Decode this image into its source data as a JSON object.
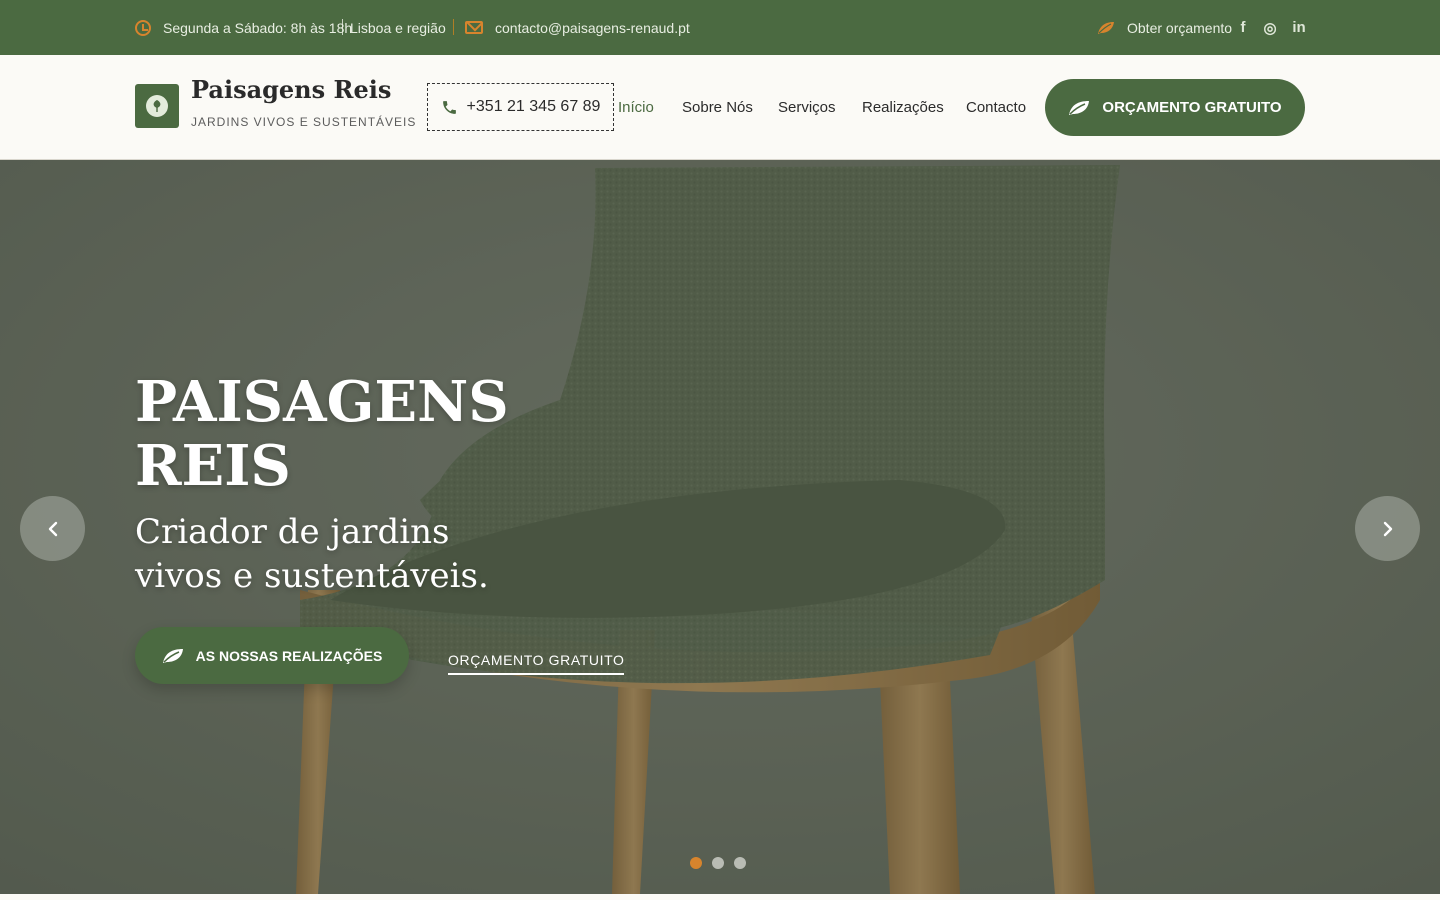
{
  "topbar": {
    "hours": "Segunda a Sábado: 8h às 18h",
    "region": "Lisboa e região",
    "email": "contacto@paisagens-renaud.pt",
    "quote_link": "Obter orçamento",
    "social": [
      {
        "icon": "facebook-icon",
        "glyph": "f"
      },
      {
        "icon": "instagram-icon",
        "glyph": "◎"
      },
      {
        "icon": "linkedin-icon",
        "glyph": "in"
      }
    ]
  },
  "header": {
    "brand_name": "Paisagens Reis",
    "brand_tagline": "JARDINS VIVOS E SUSTENTÁVEIS",
    "phone": "+351 21 345 67 89",
    "nav": [
      {
        "label": "Início",
        "active": true
      },
      {
        "label": "Sobre Nós",
        "active": false
      },
      {
        "label": "Serviços",
        "active": false
      },
      {
        "label": "Realizações",
        "active": false
      },
      {
        "label": "Contacto",
        "active": false
      }
    ],
    "cta_label": "ORÇAMENTO GRATUITO"
  },
  "hero": {
    "title_line1": "PAISAGENS",
    "title_line2": "REIS",
    "subtitle_line1": "Criador de jardins",
    "subtitle_line2": "vivos e sustentáveis.",
    "primary_button": "AS NOSSAS REALIZAÇÕES",
    "secondary_link": "ORÇAMENTO GRATUITO",
    "slides_count": 3,
    "active_slide": 1
  },
  "colors": {
    "brand_green": "#4b6a41",
    "accent_orange": "#d7842d",
    "header_bg": "#fbfaf6"
  }
}
